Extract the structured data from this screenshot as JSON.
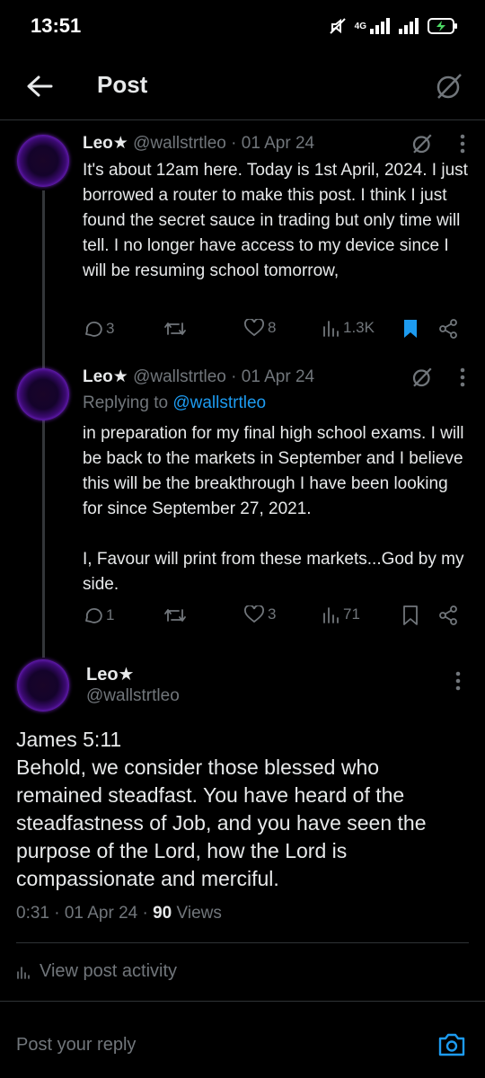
{
  "status_bar": {
    "time": "13:51",
    "network": "4G"
  },
  "header": {
    "title": "Post"
  },
  "tweets": [
    {
      "name": "Leo★",
      "handle": "@wallstrtleo",
      "date": "· 01 Apr 24",
      "text": "It's about 12am here. Today is 1st April, 2024. I just borrowed a router to make this post. I think I just found the secret sauce in trading but only time will tell. I no longer have access to my device since I will be resuming school tomorrow,",
      "replies": "3",
      "retweets": "",
      "likes": "8",
      "views": "1.3K"
    },
    {
      "name": "Leo★",
      "handle": "@wallstrtleo",
      "date": "· 01 Apr 24",
      "replying_prefix": "Replying to ",
      "replying_to": "@wallstrtleo",
      "text": "in preparation for my final high school exams. I will be back to the markets in September and I believe this will be the breakthrough I have been looking for since September 27, 2021.\n\nI, Favour will print from these markets...God by my side.",
      "replies": "1",
      "retweets": "",
      "likes": "3",
      "views": "71"
    }
  ],
  "main_tweet": {
    "name": "Leo★",
    "handle": "@wallstrtleo",
    "text": "James 5:11\nBehold, we consider those blessed who remained steadfast. You have heard of the steadfastness of Job, and you have seen the purpose of the Lord, how the Lord is compassionate and merciful.",
    "time": "0:31 · 01 Apr 24 · ",
    "views_count": "90",
    "views_label": " Views"
  },
  "activity_label": "View post activity",
  "reply": {
    "placeholder": "Post your reply"
  },
  "colors": {
    "background": "#000000",
    "accent": "#1d9bf0",
    "muted": "#71767b",
    "text": "#e7e9ea"
  }
}
